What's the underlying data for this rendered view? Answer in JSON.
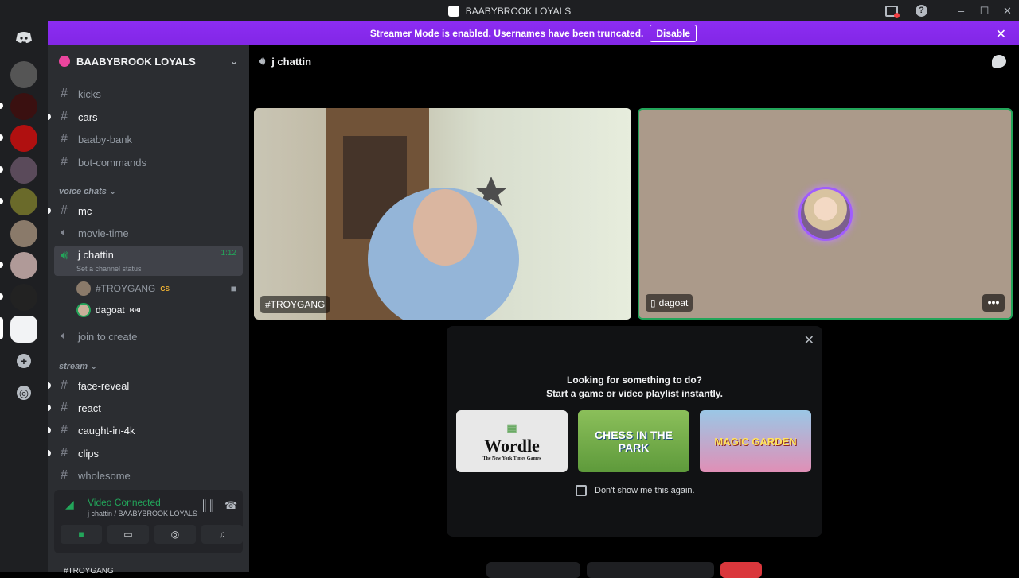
{
  "window": {
    "title": "BAABYBROOK LOYALS",
    "controls": [
      "–",
      "☐",
      "✕"
    ]
  },
  "banner": {
    "text": "Streamer Mode is enabled. Usernames have been truncated.",
    "disable_label": "Disable"
  },
  "server": {
    "name": "BAABYBROOK LOYALS"
  },
  "channels": {
    "kicks": "kicks",
    "cars": "cars",
    "baaby_bank": "baaby-bank",
    "bot_commands": "bot-commands",
    "voice_category": "voice chats",
    "mc": "mc",
    "movie_time": "movie-time",
    "j_chattin": "j chattin",
    "j_chattin_status": "Set a channel status",
    "j_chattin_time": "1:12",
    "join_to_create": "join to create",
    "stream_category": "stream",
    "face_reveal": "face-reveal",
    "react": "react",
    "caught_in_4k": "caught-in-4k",
    "clips": "clips",
    "wholesome": "wholesome"
  },
  "members": [
    {
      "name": "#TROYGANG",
      "tag": "GS"
    },
    {
      "name": "dagoat",
      "tag": "BBL"
    }
  ],
  "voice_panel": {
    "status": "Video Connected",
    "location": "j chattin / BAABYBROOK LOYALS",
    "user": "#TROYGANG"
  },
  "call": {
    "channel": "j chattin"
  },
  "tiles": [
    {
      "name": "#TROYGANG"
    },
    {
      "name": "dagoat"
    }
  ],
  "activity": {
    "line1": "Looking for something to do?",
    "line2": "Start a game or video playlist instantly.",
    "games": [
      "Wordle",
      "CHESS IN THE PARK",
      "MAGIC GARDEN"
    ],
    "wordle_sub": "The New York Times Games",
    "dont_show": "Don't show me this again."
  },
  "colors": {
    "accent": "#8c2cf2",
    "connected": "#23a55a",
    "hangup": "#da373c"
  }
}
